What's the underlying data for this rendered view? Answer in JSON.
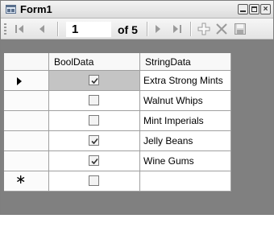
{
  "window": {
    "title": "Form1"
  },
  "navigator": {
    "position": "1",
    "count_label": "of 5",
    "buttons": [
      "move-first",
      "move-previous",
      "move-next",
      "move-last",
      "add-new",
      "delete",
      "save"
    ]
  },
  "grid": {
    "columns": [
      "BoolData",
      "StringData"
    ],
    "rows": [
      {
        "bool": true,
        "text": "Extra Strong Mints",
        "current": true
      },
      {
        "bool": false,
        "text": "Walnut Whips"
      },
      {
        "bool": false,
        "text": "Mint Imperials"
      },
      {
        "bool": true,
        "text": "Jelly Beans"
      },
      {
        "bool": true,
        "text": "Wine Gums"
      }
    ],
    "new_row_glyph": "∗"
  },
  "colors": {
    "grid_background": "#808080",
    "selected_cell": "#c4c4c4"
  }
}
